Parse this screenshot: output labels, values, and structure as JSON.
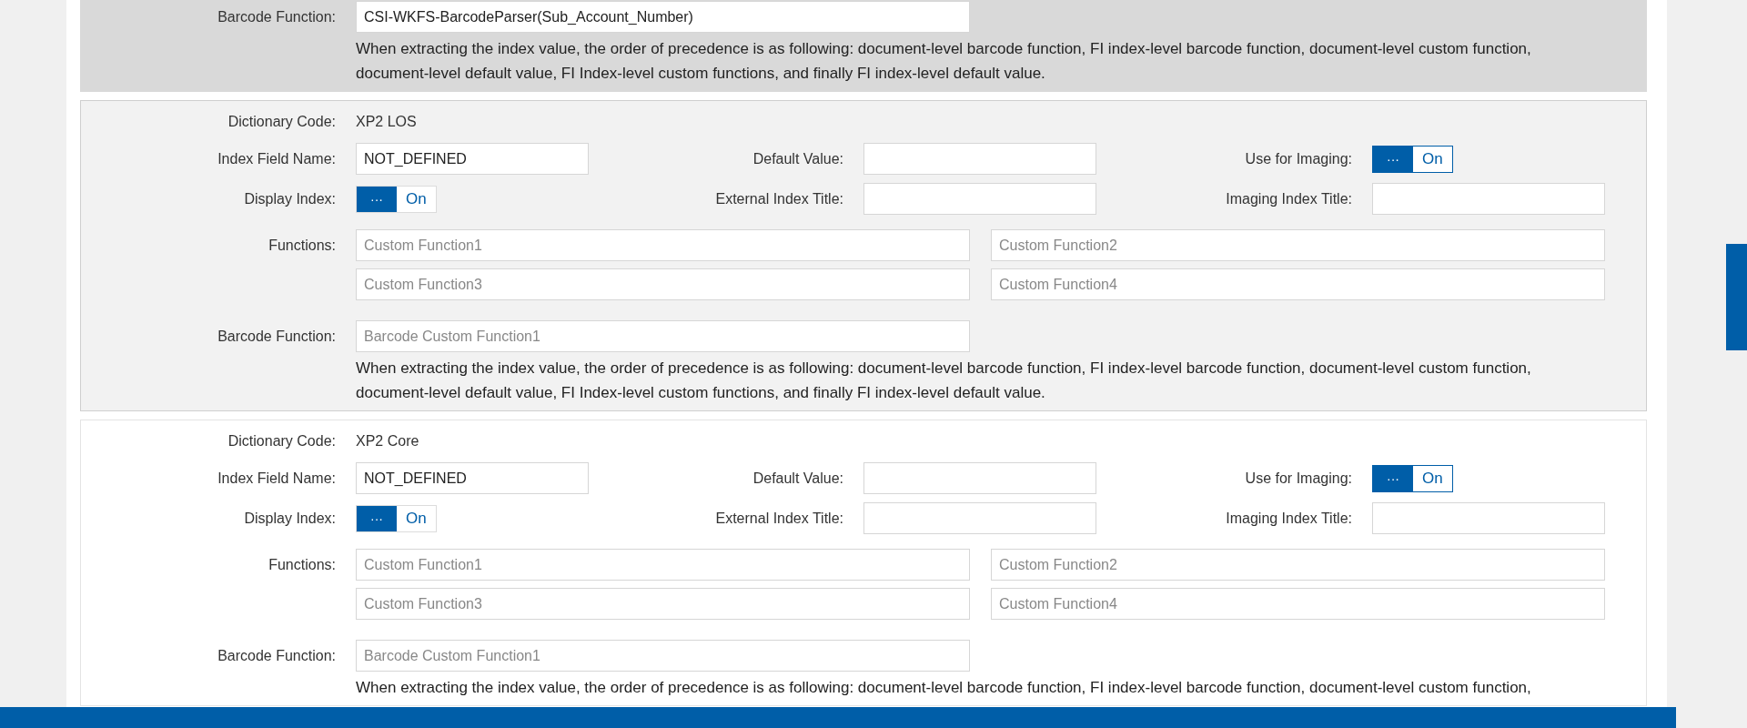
{
  "sections": [
    {
      "kind": "partial",
      "highlighted": true,
      "barcode": {
        "label": "Barcode Function:",
        "value": "CSI-WKFS-BarcodeParser(Sub_Account_Number)"
      },
      "note": "When extracting the index value, the order of precedence is as following: document-level barcode function, FI index-level barcode function, document-level custom function, document-level default value, FI Index-level custom functions, and finally FI index-level default value."
    },
    {
      "kind": "full",
      "highlighted": false,
      "shaded": true,
      "dictionary": {
        "label": "Dictionary Code:",
        "value": "XP2 LOS"
      },
      "index_field": {
        "label": "Index Field Name:",
        "value": "NOT_DEFINED"
      },
      "default_value": {
        "label": "Default Value:"
      },
      "use_for_imaging": {
        "label": "Use for Imaging:",
        "handle": "···",
        "state": "On",
        "on": true,
        "focused": true
      },
      "display_index": {
        "label": "Display Index:",
        "handle": "···",
        "state": "On",
        "on": true,
        "focused": false
      },
      "external_title": {
        "label": "External Index Title:"
      },
      "imaging_title": {
        "label": "Imaging Index Title:"
      },
      "functions": {
        "label": "Functions:",
        "placeholders": [
          "Custom Function1",
          "Custom Function2",
          "Custom Function3",
          "Custom Function4"
        ]
      },
      "barcode": {
        "label": "Barcode Function:",
        "placeholder": "Barcode Custom Function1"
      },
      "note": "When extracting the index value, the order of precedence is as following: document-level barcode function, FI index-level barcode function, document-level custom function, document-level default value, FI Index-level custom functions, and finally FI index-level default value."
    },
    {
      "kind": "full",
      "highlighted": false,
      "shaded": false,
      "dictionary": {
        "label": "Dictionary Code:",
        "value": "XP2 Core"
      },
      "index_field": {
        "label": "Index Field Name:",
        "value": "NOT_DEFINED"
      },
      "default_value": {
        "label": "Default Value:"
      },
      "use_for_imaging": {
        "label": "Use for Imaging:",
        "handle": "···",
        "state": "On",
        "on": true,
        "focused": true
      },
      "display_index": {
        "label": "Display Index:",
        "handle": "···",
        "state": "On",
        "on": true,
        "focused": false
      },
      "external_title": {
        "label": "External Index Title:"
      },
      "imaging_title": {
        "label": "Imaging Index Title:"
      },
      "functions": {
        "label": "Functions:",
        "placeholders": [
          "Custom Function1",
          "Custom Function2",
          "Custom Function3",
          "Custom Function4"
        ]
      },
      "barcode": {
        "label": "Barcode Function:",
        "placeholder": "Barcode Custom Function1"
      },
      "note": "When extracting the index value, the order of precedence is as following: document-level barcode function, FI index-level barcode function, document-level custom function,"
    }
  ]
}
